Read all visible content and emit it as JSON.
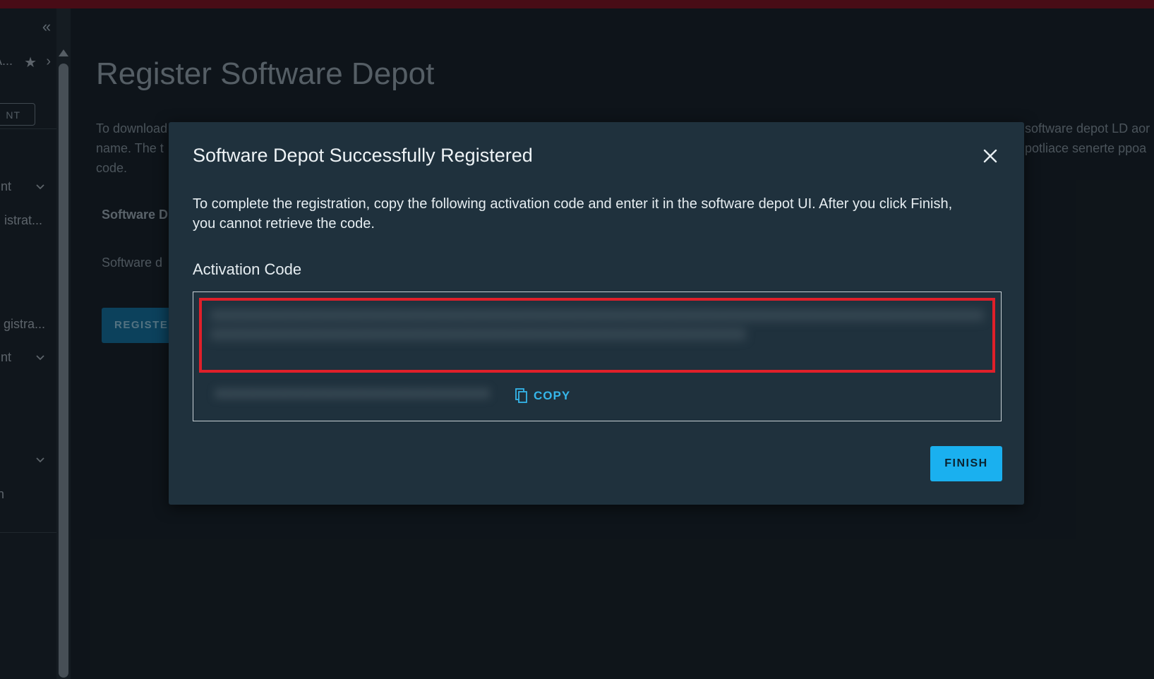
{
  "colors": {
    "top_bar": "#6b0d1a",
    "accent": "#1ab0ef",
    "link": "#35b6ea",
    "highlight": "#e0202a"
  },
  "sidebar": {
    "collapse_icon": "double-chevron-left-icon",
    "pinned_label": "A...",
    "button_label": "NT",
    "items": [
      {
        "label": "nt"
      },
      {
        "label": "istrat..."
      },
      {
        "label": "gistra..."
      },
      {
        "label": "nt"
      },
      {
        "label": ""
      },
      {
        "label": "n"
      }
    ]
  },
  "page": {
    "title": "Register Software Depot",
    "description_lines": [
      "To download",
      "name. The t",
      "code."
    ],
    "description_right_lines": [
      "software depot LD aor",
      "potliace senerte ppoa"
    ],
    "field_label": "Software D",
    "field_text": "Software d",
    "register_label": "REGISTE"
  },
  "modal": {
    "title": "Software Depot Successfully Registered",
    "message": "To complete the registration, copy the following activation code and enter it in the software depot UI. After you click Finish, you cannot retrieve the code.",
    "code_label": "Activation Code",
    "code_value": "XXXXXXXXXXXXXXXXXXXXXXXXXXXXXXXXXXXXXXXXXXXXXXXXXXXXXXXXXXXXXXXXXXXXXXXXXXXXXXXXXXXXXXXXXXXXXXXXXXXXXXXXXXXXXXXXXXXXXXXXXXXXXXXXXXXXXXXXXXXXXXXXXXXXXXXXXX",
    "code_secondary": "XXXXXXXXXXXXXXXXXXXXXXXXXXXXXXXXXXXX",
    "copy_label": "COPY",
    "finish_label": "FINISH"
  }
}
